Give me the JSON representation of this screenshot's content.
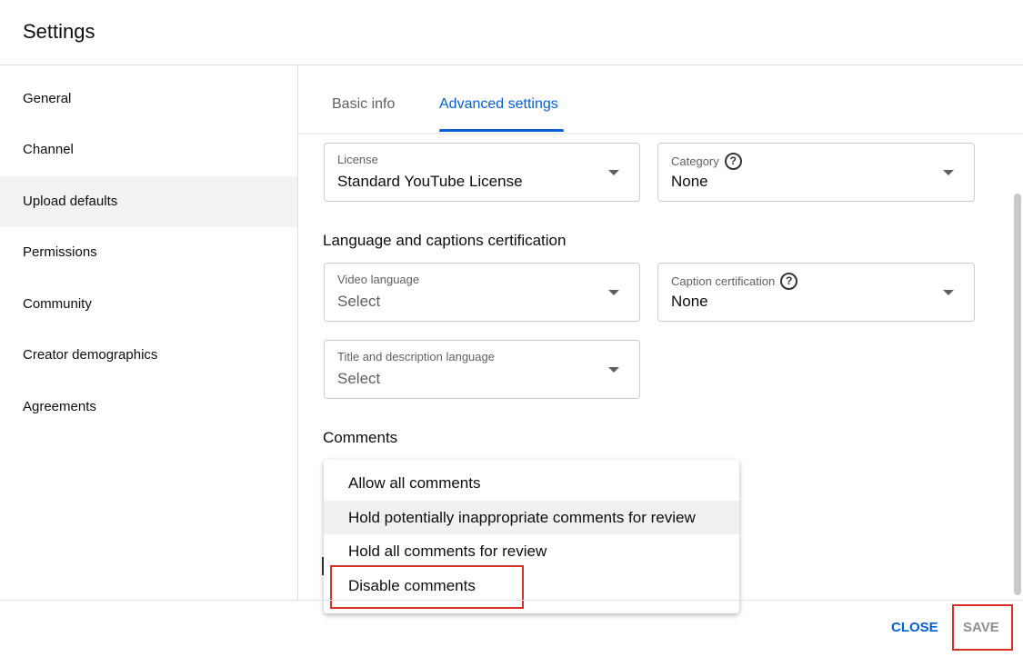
{
  "header": {
    "title": "Settings"
  },
  "sidebar": {
    "items": [
      {
        "label": "General"
      },
      {
        "label": "Channel"
      },
      {
        "label": "Upload defaults",
        "selected": true
      },
      {
        "label": "Permissions"
      },
      {
        "label": "Community"
      },
      {
        "label": "Creator demographics"
      },
      {
        "label": "Agreements"
      }
    ]
  },
  "tabs": [
    {
      "label": "Basic info"
    },
    {
      "label": "Advanced settings",
      "active": true
    }
  ],
  "fields": {
    "license": {
      "label": "License",
      "value": "Standard YouTube License"
    },
    "category": {
      "label": "Category",
      "value": "None",
      "help": "?"
    },
    "video_language": {
      "label": "Video language",
      "placeholder": "Select"
    },
    "caption_cert": {
      "label": "Caption certification",
      "value": "None",
      "help": "?"
    },
    "title_desc_language": {
      "label": "Title and description language",
      "placeholder": "Select"
    }
  },
  "sections": {
    "language": "Language and captions certification",
    "comments": "Comments"
  },
  "comments_menu": {
    "options": [
      {
        "label": "Allow all comments"
      },
      {
        "label": "Hold potentially inappropriate comments for review",
        "hovered": true
      },
      {
        "label": "Hold all comments for review"
      },
      {
        "label": "Disable comments",
        "highlighted_box": true
      }
    ]
  },
  "footer": {
    "close": "CLOSE",
    "save": "SAVE"
  },
  "colors": {
    "accent": "#065fd4",
    "annotation": "#d93025",
    "disabled": "#909090"
  }
}
